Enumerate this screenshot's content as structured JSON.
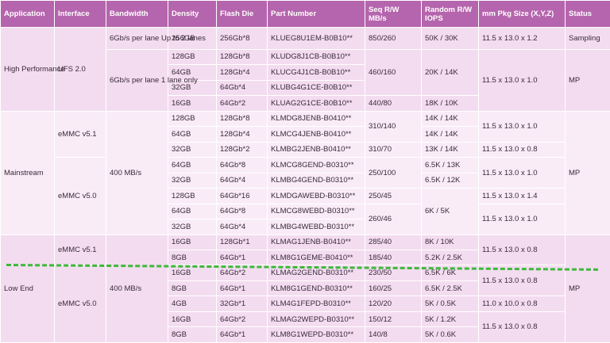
{
  "headers": [
    "Application",
    "Interface",
    "Bandwidth",
    "Density",
    "Flash Die",
    "Part Number",
    "Seq R/W MB/s",
    "Random R/W IOPS",
    "mm Pkg Size (X,Y,Z)",
    "Status"
  ],
  "groups": {
    "high": {
      "application": "High Performance",
      "interface": "UFS 2.0",
      "bandwidth_1": "6Gb/s per lane Up to 2 lanes",
      "bandwidth_2": "6Gb/s per lane 1 lane only",
      "rows": [
        {
          "density": "256GB",
          "die": "256Gb*8",
          "part": "KLUEG8U1EM-B0B10**",
          "seq": "850/260",
          "rand": "50K / 30K",
          "pkg": "11.5 x 13.0 x 1.2",
          "status": "Sampling"
        },
        {
          "density": "128GB",
          "die": "128Gb*8",
          "part": "KLUDG8J1CB-B0B10**",
          "seq": "460/160",
          "rand": "20K / 14K",
          "pkg": "11.5 x 13.0 x 1.0",
          "status": "MP"
        },
        {
          "density": "64GB",
          "die": "128Gb*4",
          "part": "KLUCG4J1CB-B0B10**"
        },
        {
          "density": "32GB",
          "die": "64Gb*4",
          "part": "KLUBG4G1CE-B0B10**"
        },
        {
          "density": "16GB",
          "die": "64Gb*2",
          "part": "KLUAG2G1CE-B0B10**",
          "seq": "440/80",
          "rand": "18K / 10K"
        }
      ]
    },
    "main": {
      "application": "Mainstream",
      "interface_1": "eMMC v5.1",
      "interface_2": "eMMC v5.0",
      "bandwidth": "400 MB/s",
      "status": "MP",
      "rows": [
        {
          "density": "128GB",
          "die": "128Gb*8",
          "part": "KLMDG8JENB-B0410**",
          "seq": "310/140",
          "rand": "14K / 14K",
          "pkg": "11.5 x 13.0 x 1.0"
        },
        {
          "density": "64GB",
          "die": "128Gb*4",
          "part": "KLMCG4JENB-B0410**",
          "rand": "14K / 14K"
        },
        {
          "density": "32GB",
          "die": "128Gb*2",
          "part": "KLMBG2JENB-B0410**",
          "seq": "310/70",
          "rand": "13K / 14K",
          "pkg": "11.5 x 13.0 x 0.8"
        },
        {
          "density": "64GB",
          "die": "64Gb*8",
          "part": "KLMCG8GEND-B0310**",
          "seq": "250/100",
          "rand": "6.5K / 13K",
          "pkg": "11.5 x 13.0 x 1.0"
        },
        {
          "density": "32GB",
          "die": "64Gb*4",
          "part": "KLMBG4GEND-B0310**",
          "rand": "6.5K / 12K"
        },
        {
          "density": "128GB",
          "die": "64Gb*16",
          "part": "KLMDGAWEBD-B0310**",
          "seq": "250/45",
          "rand": "6K / 5K",
          "pkg": "11.5 x 13.0 x 1.4"
        },
        {
          "density": "64GB",
          "die": "64Gb*8",
          "part": "KLMCG8WEBD-B0310**",
          "seq": "260/46",
          "pkg": "11.5 x 13.0 x 1.0"
        },
        {
          "density": "32GB",
          "die": "64Gb*4",
          "part": "KLMBG4WEBD-B0310**"
        }
      ]
    },
    "low": {
      "application": "Low End",
      "interface_1": "eMMC v5.1",
      "interface_2": "eMMC v5.0",
      "bandwidth": "400 MB/s",
      "status": "MP",
      "rows": [
        {
          "density": "16GB",
          "die": "128Gb*1",
          "part": "KLMAG1JENB-B0410**",
          "seq": "285/40",
          "rand": "8K / 10K",
          "pkg": "11.5 x 13.0 x 0.8"
        },
        {
          "density": "8GB",
          "die": "64Gb*1",
          "part": "KLM8G1GEME-B0410**",
          "seq": "185/40",
          "rand": "5.2K / 2.5K"
        },
        {
          "density": "16GB",
          "die": "64Gb*2",
          "part": "KLMAG2GEND-B0310**",
          "seq": "230/50",
          "rand": "6.5K / 6K",
          "pkg": "11.5 x 13.0 x 0.8"
        },
        {
          "density": "8GB",
          "die": "64Gb*1",
          "part": "KLM8G1GEND-B0310**",
          "seq": "160/25",
          "rand": "6.5K / 2.5K"
        },
        {
          "density": "4GB",
          "die": "32Gb*1",
          "part": "KLM4G1FEPD-B0310**",
          "seq": "120/20",
          "rand": "5K / 0.5K",
          "pkg": "11.0 x 10.0 x 0.8"
        },
        {
          "density": "16GB",
          "die": "64Gb*2",
          "part": "KLMAG2WEPD-B0310**",
          "seq": "150/12",
          "rand": "5K / 1.2K",
          "pkg": "11.5 x 13.0 x 0.8"
        },
        {
          "density": "8GB",
          "die": "64Gb*1",
          "part": "KLM8G1WEPD-B0310**",
          "seq": "140/8",
          "rand": "5K / 0.6K"
        }
      ]
    }
  },
  "colors": {
    "header": "#b565ad",
    "row_dark": "#f3dcf0",
    "row_light": "#f9ecf7",
    "divider": "#3db83a"
  }
}
